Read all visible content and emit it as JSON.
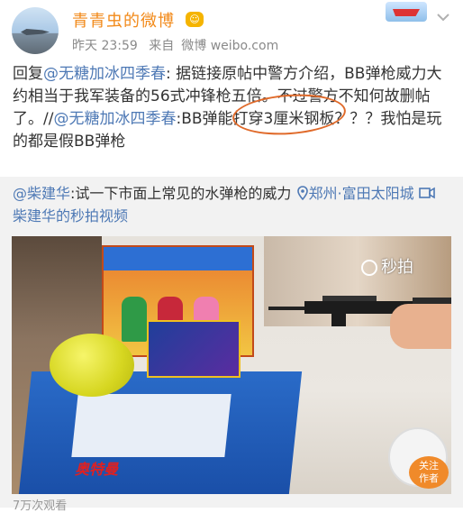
{
  "header": {
    "username": "青青虫的微博",
    "vip_icon": "vip-badge",
    "time": "昨天 23:59",
    "source_prefix": "来自",
    "source": "微博 weibo.com"
  },
  "post": {
    "text_1": "回复",
    "mention_1": "@无糖加冰四季春",
    "text_2": ": 据链接原帖中警方介绍，BB弹枪威力大约相当于我军装备的56式冲锋枪五倍。不过警方不知何故删帖了。//",
    "mention_2": "@无糖加冰四季春",
    "text_3": ":BB弹能打穿3厘米钢板？？？我怕是玩的都是假BB弹枪"
  },
  "repost": {
    "author": "@柴建华",
    "text": ":试一下市面上常见的水弹枪的威力",
    "location_icon": "location-pin-icon",
    "location": "郑州·富田太阳城",
    "video_icon": "video-icon",
    "video_link": "柴建华的秒拍视频"
  },
  "video": {
    "watermark": "秒拍",
    "follow_line1": "关注",
    "follow_line2": "作者",
    "box_logo": "奥特曼"
  },
  "footer": {
    "views": "7万次观看"
  },
  "colors": {
    "username": "#f28a1a",
    "link": "#4e79b5",
    "annotation": "#e06a2a"
  }
}
